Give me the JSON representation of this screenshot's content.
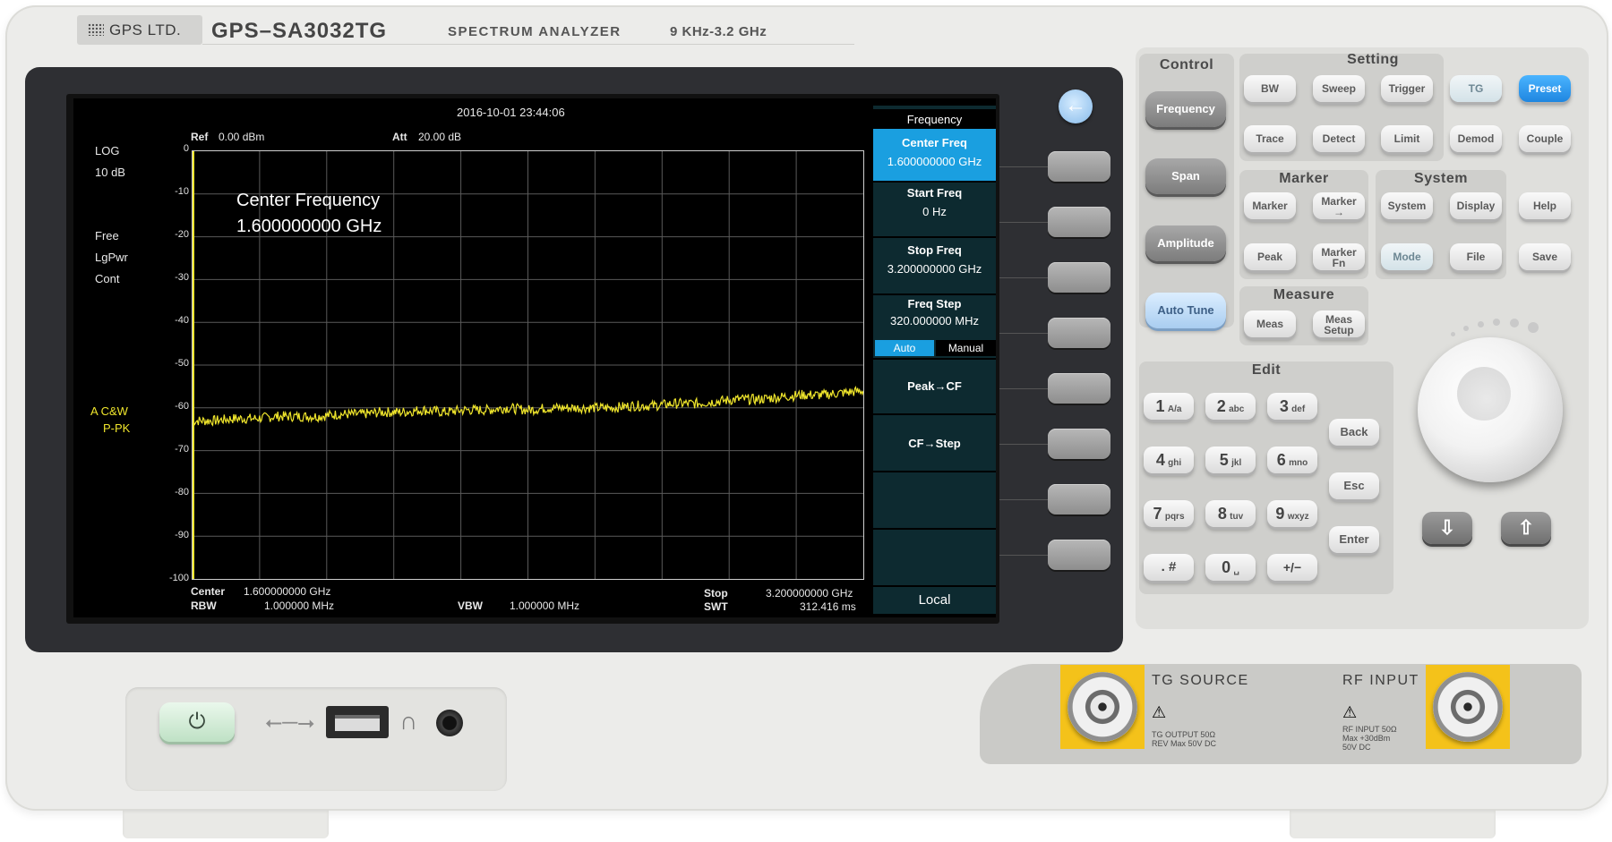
{
  "header": {
    "brand": "GPS LTD.",
    "model": "GPS–SA3032TG",
    "type": "SPECTRUM ANALYZER",
    "range": "9 KHz-3.2 GHz"
  },
  "screen": {
    "datetime": "2016-10-01   23:44:06",
    "ref_label": "Ref",
    "ref_value": "0.00 dBm",
    "att_label": "Att",
    "att_value": "20.00 dB",
    "left_status": [
      "LOG",
      "10 dB",
      "Free",
      "LgPwr",
      "Cont"
    ],
    "trace_status": [
      "A  C&W",
      "P-PK"
    ],
    "y_ticks": [
      "0",
      "-10",
      "-20",
      "-30",
      "-40",
      "-50",
      "-60",
      "-70",
      "-80",
      "-90",
      "-100"
    ],
    "annotation_title": "Center Frequency",
    "annotation_value": "1.600000000 GHz",
    "bottom": {
      "center_label": "Center",
      "center_value": "1.600000000 GHz",
      "rbw_label": "RBW",
      "rbw_value": "1.000000 MHz",
      "vbw_label": "VBW",
      "vbw_value": "1.000000 MHz",
      "stop_label": "Stop",
      "stop_value": "3.200000000 GHz",
      "swt_label": "SWT",
      "swt_value": "312.416 ms"
    },
    "menu": {
      "title": "Frequency",
      "center_freq_label": "Center Freq",
      "center_freq_value": "1.600000000 GHz",
      "start_freq_label": "Start Freq",
      "start_freq_value": "0 Hz",
      "stop_freq_label": "Stop Freq",
      "stop_freq_value": "3.200000000 GHz",
      "freq_step_label": "Freq Step",
      "freq_step_value": "320.000000 MHz",
      "auto": "Auto",
      "manual": "Manual",
      "peak_cf": "Peak→CF",
      "cf_step": "CF→Step",
      "local": "Local"
    }
  },
  "panel": {
    "control": {
      "title": "Control",
      "frequency": "Frequency",
      "span": "Span",
      "amplitude": "Amplitude",
      "auto_tune": "Auto Tune"
    },
    "setting": {
      "title": "Setting",
      "bw": "BW",
      "sweep": "Sweep",
      "trigger": "Trigger",
      "tg": "TG",
      "preset": "Preset",
      "trace": "Trace",
      "detect": "Detect",
      "limit": "Limit",
      "demod": "Demod",
      "couple": "Couple"
    },
    "marker": {
      "title": "Marker",
      "marker": "Marker",
      "marker_arrow": "Marker\n→",
      "peak": "Peak",
      "marker_fn": "Marker\nFn"
    },
    "system": {
      "title": "System",
      "system": "System",
      "display": "Display",
      "help": "Help",
      "mode": "Mode",
      "file": "File",
      "save": "Save"
    },
    "measure": {
      "title": "Measure",
      "meas": "Meas",
      "meas_setup": "Meas\nSetup"
    },
    "edit": {
      "title": "Edit",
      "keys": [
        {
          "n": "1",
          "s": "A/a"
        },
        {
          "n": "2",
          "s": "abc"
        },
        {
          "n": "3",
          "s": "def"
        },
        {
          "n": "4",
          "s": "ghi"
        },
        {
          "n": "5",
          "s": "jkl"
        },
        {
          "n": "6",
          "s": "mno"
        },
        {
          "n": "7",
          "s": "pqrs"
        },
        {
          "n": "8",
          "s": "tuv"
        },
        {
          "n": "9",
          "s": "wxyz"
        },
        {
          "n": ". #",
          "s": ""
        },
        {
          "n": "0",
          "s": "␣"
        },
        {
          "n": "+/−",
          "s": ""
        }
      ],
      "back": "Back",
      "esc": "Esc",
      "enter": "Enter"
    }
  },
  "connectors": {
    "tg_source": "TG SOURCE",
    "rf_input": "RF INPUT",
    "tg_note": "TG OUTPUT 50Ω\nREV Max 50V DC",
    "rf_note": "RF INPUT 50Ω\nMax +30dBm\n50V DC"
  },
  "chart_data": {
    "type": "line",
    "x": [
      0,
      0.1,
      0.2,
      0.3,
      0.4,
      0.5,
      0.6,
      0.7,
      0.8,
      0.9,
      1.0,
      1.1,
      1.2,
      1.3,
      1.4,
      1.5,
      1.6,
      1.7,
      1.8,
      1.9,
      2.0,
      2.1,
      2.2,
      2.3,
      2.4,
      2.5,
      2.6,
      2.7,
      2.8,
      2.9,
      3.0,
      3.1,
      3.2
    ],
    "series": [
      {
        "values": [
          -63,
          -63,
          -62.5,
          -62.5,
          -62,
          -62,
          -62,
          -61.5,
          -61.5,
          -61,
          -61,
          -60.5,
          -61,
          -60.5,
          -60.5,
          -60,
          -60.5,
          -60,
          -60,
          -60,
          -60,
          -59.5,
          -59.5,
          -59,
          -59,
          -58.5,
          -58,
          -58,
          -57.5,
          -57,
          -57,
          -56.5,
          -56
        ]
      }
    ],
    "ylim": [
      -100,
      0
    ],
    "xlim": [
      0,
      3.2
    ],
    "grid": true,
    "trace_color": "#f0e62c"
  }
}
